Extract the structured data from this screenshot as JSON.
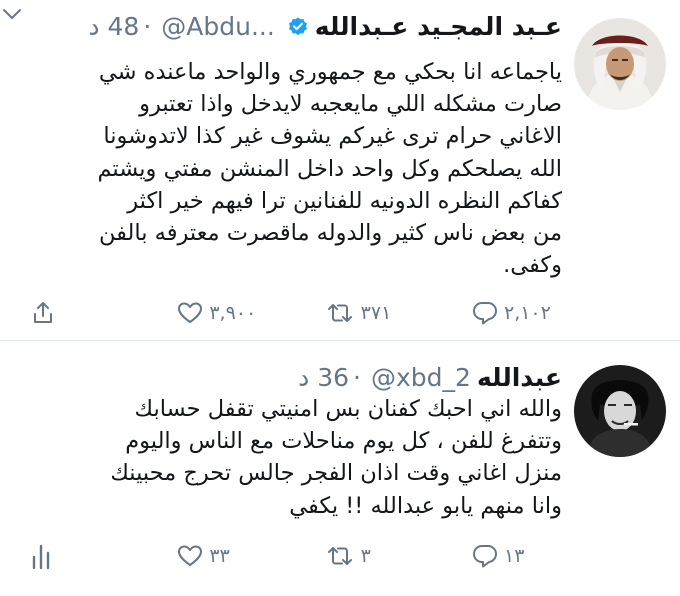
{
  "tweets": [
    {
      "name": "عـبد المجـيد عـبدالله",
      "handle": "@Abdu...",
      "separator": "·",
      "time": "48 د",
      "verified": true,
      "lines": [
        "ياجماعه انا بحكي مع جمهوري والواحد ماعنده شي",
        "صارت مشكله اللي مايعجبه لايدخل واذا تعتبرو",
        "الاغاني حرام ترى غيركم يشوف غير كذا لاتدوشونا",
        "الله يصلحكم وكل واحد داخل المنشن مفتي ويشتم",
        "كفاكم النظره الدونيه للفنانين ترا فيهم خير اكثر",
        "من بعض ناس كثير والدوله ماقصرت معترفه بالفن",
        "وكفى."
      ],
      "replies": "٢,١٠٢",
      "retweets": "٣٧١",
      "likes": "٣,٩٠٠"
    },
    {
      "name": "عبدالله",
      "handle": "@xbd_2",
      "separator": "·",
      "time": "36 د",
      "verified": false,
      "lines": [
        "والله اني احبك كفنان بس امنيتي تقفل حسابك",
        "وتتفرغ للفن ، كل يوم مناحلات مع الناس واليوم",
        "منزل اغاني وقت اذان الفجر جالس تحرج محبينك",
        "وانا منهم يابو عبدالله !! يكفي"
      ],
      "replies": "١٣",
      "retweets": "٣",
      "likes": "٣٣"
    }
  ],
  "colors": {
    "text": "#14171a",
    "secondary": "#657786",
    "verified_badge": "#1da1f2",
    "divider": "#e1e8ed"
  },
  "icons": [
    "chevron-down-icon",
    "verified-badge-icon",
    "reply-icon",
    "retweet-icon",
    "like-icon",
    "share-icon",
    "analytics-icon"
  ]
}
